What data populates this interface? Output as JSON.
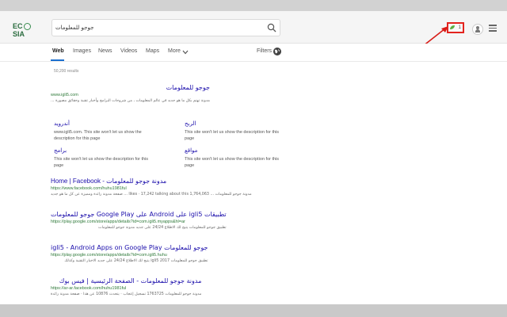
{
  "app": {
    "logo_text": "ECOSIA",
    "logo_letters": [
      "EC",
      "SIA"
    ]
  },
  "search": {
    "query": "جوجو للمعلومات"
  },
  "header": {
    "trees_count": "1"
  },
  "nav": {
    "tabs": [
      {
        "label": "Web",
        "active": true
      },
      {
        "label": "Images"
      },
      {
        "label": "News"
      },
      {
        "label": "Videos"
      },
      {
        "label": "Maps"
      },
      {
        "label": "More"
      }
    ],
    "filters_label": "Filters"
  },
  "results": {
    "count_text": "50,200 results",
    "items": [
      {
        "title": "جوجو للمعلومات",
        "url": "www.igli5.com",
        "desc": "مدونة تهتم بكل ما هو جديد في عالم المعلومات ، من شروحات البرامج وأخبار تقنية وحقائق مصورة ...",
        "sublinks": [
          {
            "title": "أندرويد",
            "desc": "www.igli5.com. This site won't let us show the description for this page"
          },
          {
            "title": "الربح",
            "desc": "This site won't let us show the description for this page"
          },
          {
            "title": "برامج",
            "desc": "This site won't let us show the description for this page"
          },
          {
            "title": "مواقع",
            "desc": "This site won't let us show the description for this page"
          }
        ]
      },
      {
        "title": "Home | Facebook - مدونة جوجو للمعلومات",
        "url": "https://www.facebook.com/huhu1981ful",
        "desc": "مدونة جوجو للمعلومات ... 1,764,063 likes · 17,242 talking about this ... صفحة مدونة رائدة ومميزة عن كل ما هو جديد"
      },
      {
        "title": "تطبيقات igli5 على Android على Google Play جوجو للمعلومات",
        "url": "https://play.google.com/store/apps/details?id=com.igli5.myapps&hl=ar",
        "desc": "تطبيق جوجو للمعلومات يتيح لك الاطلاع 24/24 على جديد مدونة جوجو للمعلومات"
      },
      {
        "title": "جوجو للمعلومات igli5 - Android Apps on Google Play",
        "url": "https://play.google.com/store/apps/details?id=com.igli5.huhu",
        "desc": "تطبيق جوجو للمعلومات 2017 igli5 يتيح لك الاطلاع 24/24 على جديد الاخبار التقنية وكذلك"
      },
      {
        "title": "مدونة جوجو للمعلومات - الصفحة الرئيسية | فيس بوك",
        "url": "https://ar-ar.facebook.com/huhu1981ful",
        "desc": "مدونة جوجو للمعلومات 1763725 تسجيل إعجاب · يتحدث 10876 عن هذا · صفحة مدونة رائدة"
      }
    ]
  },
  "colors": {
    "accent": "#1b6fcf",
    "link": "#1a0dab",
    "url": "#2f7a3a",
    "highlight": "#e3231e"
  }
}
